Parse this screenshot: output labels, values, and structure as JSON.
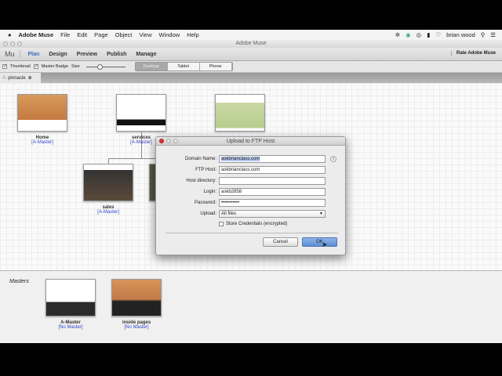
{
  "menubar": {
    "app": "Adobe Muse",
    "items": [
      "File",
      "Edit",
      "Page",
      "Object",
      "View",
      "Window",
      "Help"
    ],
    "user": "brian wood"
  },
  "window": {
    "title": "Adobe Muse"
  },
  "toolbar": {
    "logo": "Mu",
    "tabs": [
      "Plan",
      "Design",
      "Preview",
      "Publish",
      "Manage"
    ],
    "active": "Plan",
    "rate": "Rate Adobe Muse"
  },
  "options": {
    "thumbnail": "Thumbnail",
    "master_badge": "Master Badge",
    "size": "Size",
    "size_value": 0.25,
    "views": [
      "Desktop",
      "Tablet",
      "Phone"
    ],
    "active_view": "Desktop"
  },
  "doc_tab": {
    "label": "pinnacle"
  },
  "sitemap": {
    "pages": [
      {
        "name": "Home",
        "master": "[A-Master]"
      },
      {
        "name": "services",
        "master": "[A-Master]"
      },
      {
        "name": "sales",
        "master": "[A-Master]"
      }
    ]
  },
  "masters": {
    "label": "Masters",
    "items": [
      {
        "name": "A-Master",
        "master": "[No Master]"
      },
      {
        "name": "inside pages",
        "master": "[No Master]"
      }
    ]
  },
  "dialog": {
    "title": "Upload to FTP Host",
    "fields": [
      {
        "label": "Domain Name:",
        "value": "askbrianclass.com"
      },
      {
        "label": "FTP Host:",
        "value": "askbrianclass.com"
      },
      {
        "label": "Host directory:",
        "value": ""
      },
      {
        "label": "Login:",
        "value": "askb2858"
      },
      {
        "label": "Password:",
        "value": "•••••••••••"
      },
      {
        "label": "Upload:",
        "value": "All files"
      }
    ],
    "store": "Store Credentials (encrypted)",
    "cancel": "Cancel",
    "ok": "OK"
  }
}
